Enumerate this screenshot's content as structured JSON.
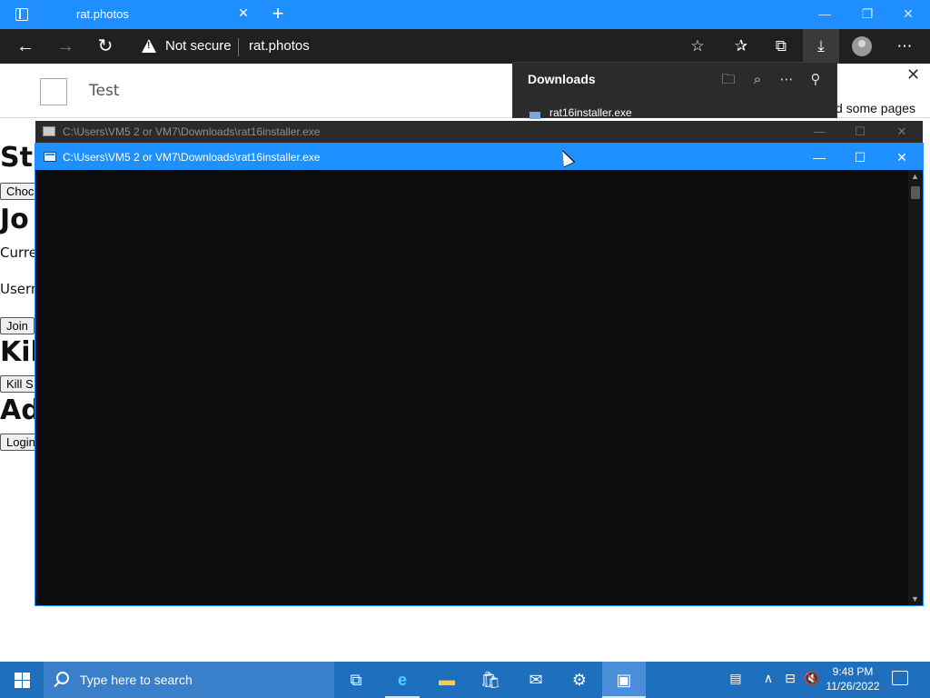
{
  "browser": {
    "tab_title": "rat.photos",
    "tab_close": "✕",
    "new_tab": "+",
    "window_controls": {
      "minimize": "—",
      "restore": "❐",
      "close": "✕"
    },
    "nav": {
      "back": "←",
      "forward": "→",
      "refresh": "↻"
    },
    "security_label": "Not secure",
    "url": "rat.photos",
    "toolbar_icons": {
      "add_favorite": "☆",
      "favorites": "✰",
      "collections": "⧉",
      "downloads": "⤓",
      "more": "⋯"
    }
  },
  "page": {
    "header_title": "Test",
    "h1": "St",
    "btn_choose": "Choc",
    "h2": "Jo",
    "text_current": "Curre",
    "text_username": "Usern",
    "btn_join": "Join",
    "h3": "Kill",
    "btn_kill": "Kill S",
    "h4": "Ad",
    "btn_login": "Login",
    "right_text": "d some pages",
    "right_close": "✕"
  },
  "downloads": {
    "title": "Downloads",
    "icons": {
      "open_folder": "🗀",
      "search": "⌕",
      "more": "⋯",
      "pin": "⚲"
    },
    "file_name": "rat16installer.exe"
  },
  "console_back": {
    "title": "C:\\Users\\VM5 2 or VM7\\Downloads\\rat16installer.exe",
    "controls": {
      "minimize": "—",
      "maximize": "☐",
      "close": "✕"
    }
  },
  "console": {
    "title": "C:\\Users\\VM5 2 or VM7\\Downloads\\rat16installer.exe",
    "controls": {
      "minimize": "—",
      "maximize": "☐",
      "close": "✕"
    },
    "scroll_up": "▲",
    "scroll_down": "▼"
  },
  "taskbar": {
    "search_placeholder": "Type here to search",
    "task_view": "⧉",
    "edge": "e",
    "explorer": "▬",
    "store": "🛍",
    "mail": "✉",
    "settings": "⚙",
    "console_app": "▣",
    "tray": {
      "news": "▤",
      "chevron": "∧",
      "network": "⊟",
      "volume": "🔇"
    },
    "time": "9:48 PM",
    "date": "11/26/2022"
  },
  "colors": {
    "tab_bar": "#1f8fff",
    "toolbar": "#202020",
    "console_bg": "#0c0c0c",
    "console_title_active": "#1e90ff",
    "taskbar": "#1f6fbf"
  }
}
